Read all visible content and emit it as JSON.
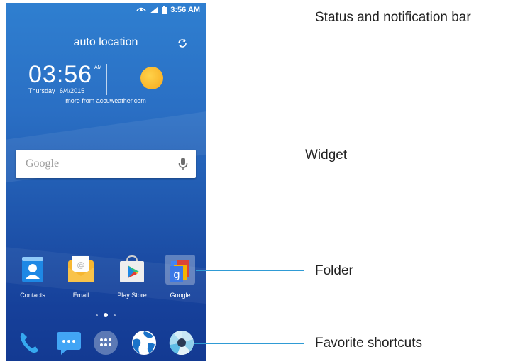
{
  "status_bar": {
    "time": "3:56 AM"
  },
  "weather_widget": {
    "location": "auto location",
    "time": "03:56",
    "ampm": "AM",
    "day": "Thursday",
    "date": "6/4/2015",
    "link": "more from accuweather.com"
  },
  "search_widget": {
    "placeholder": "Google"
  },
  "apps": [
    {
      "label": "Contacts",
      "icon": "contacts-icon"
    },
    {
      "label": "Email",
      "icon": "email-icon"
    },
    {
      "label": "Play Store",
      "icon": "play-store-icon"
    },
    {
      "label": "Google",
      "icon": "google-folder-icon"
    }
  ],
  "dock": [
    {
      "icon": "phone-icon"
    },
    {
      "icon": "messaging-icon"
    },
    {
      "icon": "app-drawer-icon"
    },
    {
      "icon": "browser-icon"
    },
    {
      "icon": "camera-icon"
    }
  ],
  "callouts": {
    "status": "Status and notification bar",
    "widget": "Widget",
    "folder": "Folder",
    "favorites": "Favorite shortcuts"
  },
  "colors": {
    "wallpaper_top": "#2f7fd0",
    "wallpaper_bottom": "#133a92",
    "callout_line": "#2f9bd5",
    "sun": "#f7a81c"
  }
}
